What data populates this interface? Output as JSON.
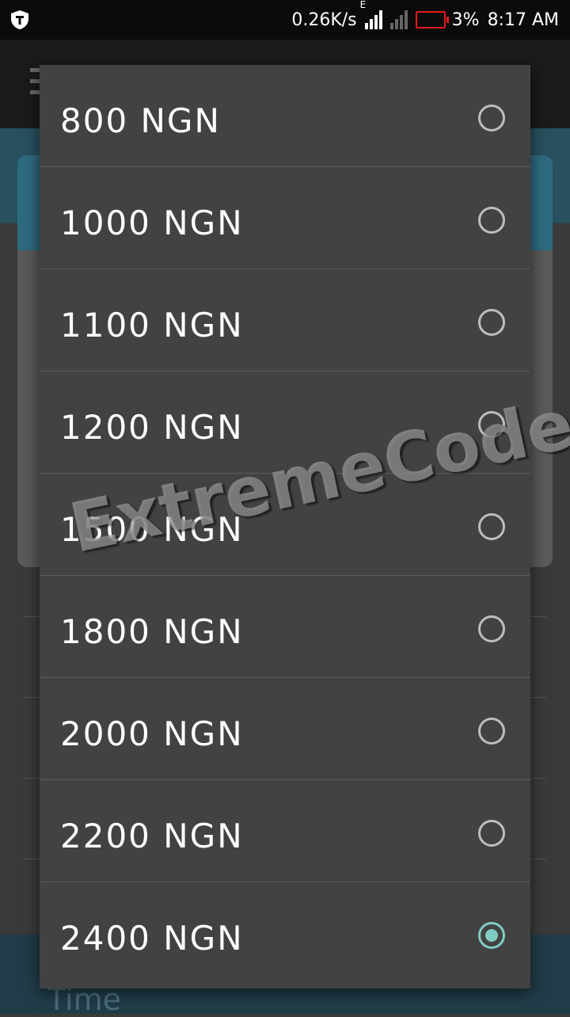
{
  "status_bar": {
    "speed": "0.26K/s",
    "network_type": "E",
    "battery_percent": "3%",
    "time": "8:17 AM",
    "battery_color": "#e21b1b"
  },
  "background": {
    "time_label": "Time"
  },
  "dropdown": {
    "options": [
      {
        "label": "800 NGN",
        "selected": false
      },
      {
        "label": "1000 NGN",
        "selected": false
      },
      {
        "label": "1100 NGN",
        "selected": false
      },
      {
        "label": "1200 NGN",
        "selected": false
      },
      {
        "label": "1500 NGN",
        "selected": false
      },
      {
        "label": "1800 NGN",
        "selected": false
      },
      {
        "label": "2000 NGN",
        "selected": false
      },
      {
        "label": "2200 NGN",
        "selected": false
      },
      {
        "label": "2400 NGN",
        "selected": true
      }
    ],
    "accent_color": "#80cbc4"
  },
  "watermark": "ExtremeCodez.Com"
}
